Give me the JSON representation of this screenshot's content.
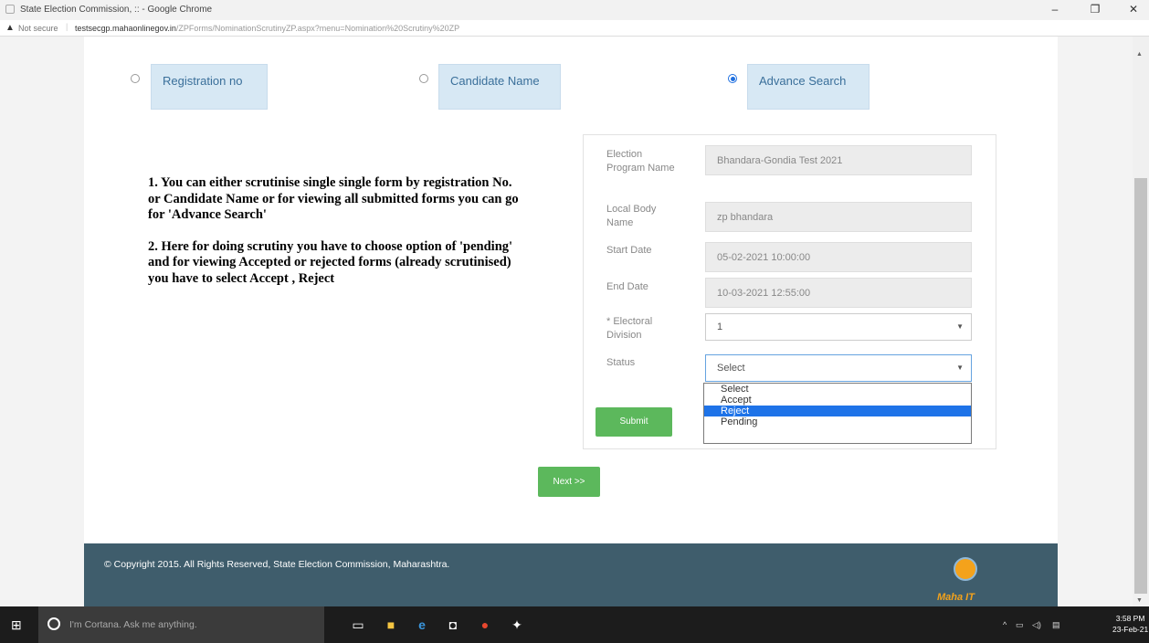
{
  "browser": {
    "title": "State Election Commission, :: - Google Chrome",
    "not_secure": "Not secure",
    "url_host": "testsecgp.mahaonlinegov.in",
    "url_path": "/ZPForms/NominationScrutinyZP.aspx?menu=Nomination%20Scrutiny%20ZP"
  },
  "search_options": [
    {
      "label": "Registration no",
      "checked": false
    },
    {
      "label": "Candidate Name",
      "checked": false
    },
    {
      "label": "Advance Search",
      "checked": true
    }
  ],
  "instructions": [
    "1. You can either scrutinise single single form by registration No. or Candidate Name or for viewing all submitted forms you can go for 'Advance Search'",
    "2. Here for doing scrutiny you have to choose option of 'pending' and for viewing Accepted or rejected forms (already scrutinised) you have to select Accept , Reject"
  ],
  "form": {
    "election_program_label": "Election Program Name",
    "election_program_value": "Bhandara-Gondia Test 2021",
    "local_body_label": "Local Body Name",
    "local_body_value": "zp bhandara",
    "start_date_label": "Start Date",
    "start_date_value": "05-02-2021 10:00:00",
    "end_date_label": "End Date",
    "end_date_value": "10-03-2021 12:55:00",
    "electoral_division_label": "* Electoral Division",
    "electoral_division_value": "1",
    "status_label": "Status",
    "status_value": "Select",
    "status_options": [
      "Select",
      "Accept",
      "Reject",
      "Pending"
    ],
    "status_highlighted": "Reject",
    "submit_label": "Submit"
  },
  "next_label": "Next >>",
  "footer": {
    "copyright": "© Copyright 2015. All Rights Reserved, State Election Commission, Maharashtra.",
    "logo_text": "Maha IT"
  },
  "taskbar": {
    "cortana_placeholder": "I'm Cortana. Ask me anything.",
    "time": "3:58 PM",
    "date": "23-Feb-21"
  }
}
